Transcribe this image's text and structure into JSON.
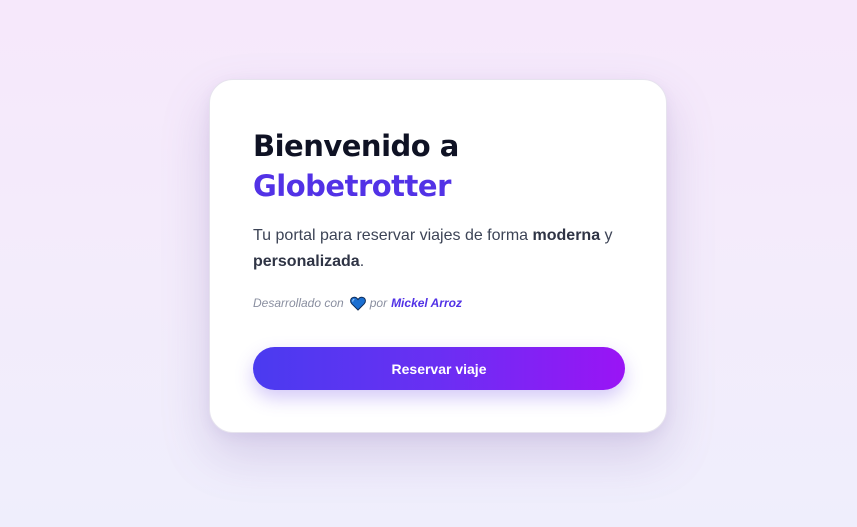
{
  "welcome": {
    "title_line1": "Bienvenido a",
    "brand": "Globetrotter",
    "description": {
      "part1": "Tu portal para reservar viajes de forma ",
      "bold1": "moderna",
      "part2": " y ",
      "bold2": "personalizada",
      "part3": "."
    },
    "credit": {
      "prefix": "Desarrollado con",
      "heart_icon": "heart-icon",
      "heart_color": "#1b6fd1",
      "by": "por",
      "author": "Mickel Arroz"
    },
    "cta_label": "Reservar viaje"
  },
  "colors": {
    "accent": "#5232e6",
    "title": "#0f1224",
    "button_gradient_start": "#4a3bf0",
    "button_gradient_end": "#9a14f5"
  }
}
